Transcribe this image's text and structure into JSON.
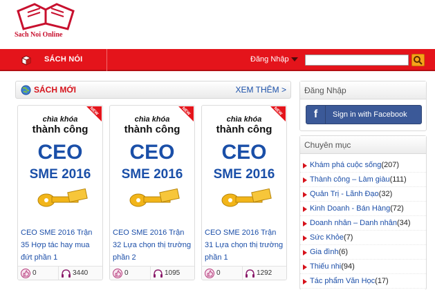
{
  "logo": {
    "text": "Sach Noi Online"
  },
  "topbar": {
    "nav_label": "SÁCH NÓI",
    "login_label": "Đăng Nhập",
    "search_value": "",
    "colors": {
      "bar": "#e4141b",
      "search_button": "#f7a21b"
    }
  },
  "new_books": {
    "title": "SÁCH MỚI",
    "more_label": "XEM THÊM >",
    "cards": [
      {
        "cover_brand_1": "chìa khóa",
        "cover_brand_2": "thành công",
        "cover_ceo": "CEO",
        "cover_sme": "SME 2016",
        "badge": "NEW",
        "title": "CEO SME 2016 Trận 35 Hợp tác hay mua đứt phần 1",
        "likes": "0",
        "listens": "3440"
      },
      {
        "cover_brand_1": "chìa khóa",
        "cover_brand_2": "thành công",
        "cover_ceo": "CEO",
        "cover_sme": "SME 2016",
        "badge": "NEW",
        "title": "CEO SME 2016 Trận 32 Lựa chọn thị trường phần 2",
        "likes": "0",
        "listens": "1095"
      },
      {
        "cover_brand_1": "chìa khóa",
        "cover_brand_2": "thành công",
        "cover_ceo": "CEO",
        "cover_sme": "SME 2016",
        "badge": "NEW",
        "title": "CEO SME 2016 Trận 31 Lựa chọn thị trường phần 1",
        "likes": "0",
        "listens": "1292"
      }
    ]
  },
  "sidebar": {
    "login_title": "Đăng Nhập",
    "facebook_label": "Sign in with Facebook",
    "facebook_letter": "f",
    "categories_title": "Chuyên mục",
    "categories": [
      {
        "name": "Khám phá cuộc sống",
        "count": "(207)"
      },
      {
        "name": "Thành công – Làm giàu",
        "count": "(111)"
      },
      {
        "name": "Quản Trị - Lãnh Đạo",
        "count": "(32)"
      },
      {
        "name": "Kinh Doanh - Bán Hàng",
        "count": "(72)"
      },
      {
        "name": "Doanh nhân – Danh nhân",
        "count": "(34)"
      },
      {
        "name": "Sức Khỏe",
        "count": "(7)"
      },
      {
        "name": "Gia đình",
        "count": "(6)"
      },
      {
        "name": "Thiếu nhi",
        "count": "(94)"
      },
      {
        "name": "Tác phẩm Văn Học",
        "count": "(17)"
      }
    ]
  }
}
